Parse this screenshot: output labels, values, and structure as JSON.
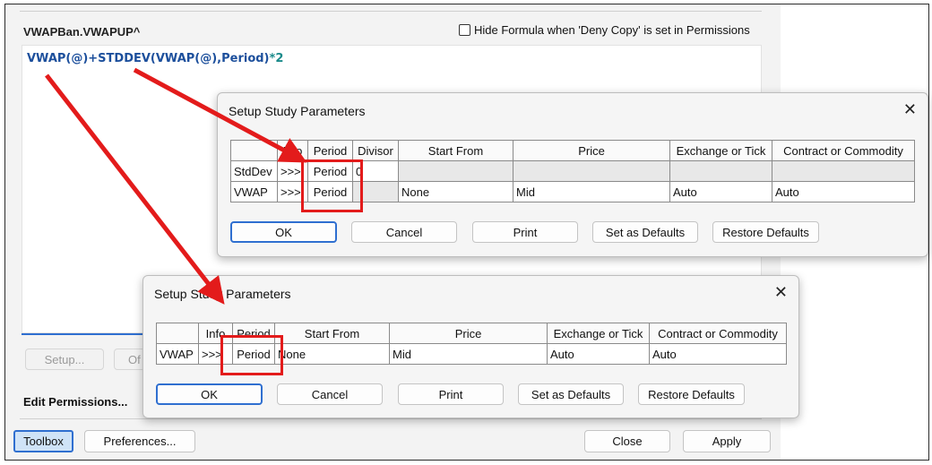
{
  "main": {
    "study_name": "VWAPBan.VWAPUP^",
    "hide_formula_label": "Hide Formula when 'Deny Copy' is set in Permissions",
    "formula": {
      "part1": "VWAP(@)+STDDEV(VWAP(@),Period)",
      "op": "*",
      "part2": "2"
    },
    "setup_label": "Setup...",
    "partial_button_label": "Of",
    "edit_permissions_label": "Edit Permissions...",
    "toolbox_label": "Toolbox",
    "preferences_label": "Preferences...",
    "close_label": "Close",
    "apply_label": "Apply"
  },
  "dialog1": {
    "title": "Setup Study Parameters",
    "headers": [
      "",
      "Info",
      "Period",
      "Divisor",
      "Start From",
      "Price",
      "Exchange or Tick",
      "Contract or Commodity"
    ],
    "rows": [
      [
        "StdDev",
        ">>>",
        "Period",
        "0",
        "",
        "",
        "",
        ""
      ],
      [
        "VWAP",
        ">>>",
        "Period",
        "",
        "None",
        "Mid",
        "Auto",
        "Auto"
      ]
    ],
    "buttons": {
      "ok": "OK",
      "cancel": "Cancel",
      "print": "Print",
      "set_defaults": "Set as Defaults",
      "restore_defaults": "Restore Defaults"
    }
  },
  "dialog2": {
    "title": "Setup Study Parameters",
    "headers": [
      "",
      "Info",
      "Period",
      "Start From",
      "Price",
      "Exchange or Tick",
      "Contract or Commodity"
    ],
    "rows": [
      [
        "VWAP",
        ">>>",
        "Period",
        "None",
        "Mid",
        "Auto",
        "Auto"
      ]
    ],
    "buttons": {
      "ok": "OK",
      "cancel": "Cancel",
      "print": "Print",
      "set_defaults": "Set as Defaults",
      "restore_defaults": "Restore Defaults"
    }
  },
  "colors": {
    "accent": "#2f6fd0",
    "annotation_red": "#e31b1b",
    "formula_blue": "#1c4f9c"
  }
}
